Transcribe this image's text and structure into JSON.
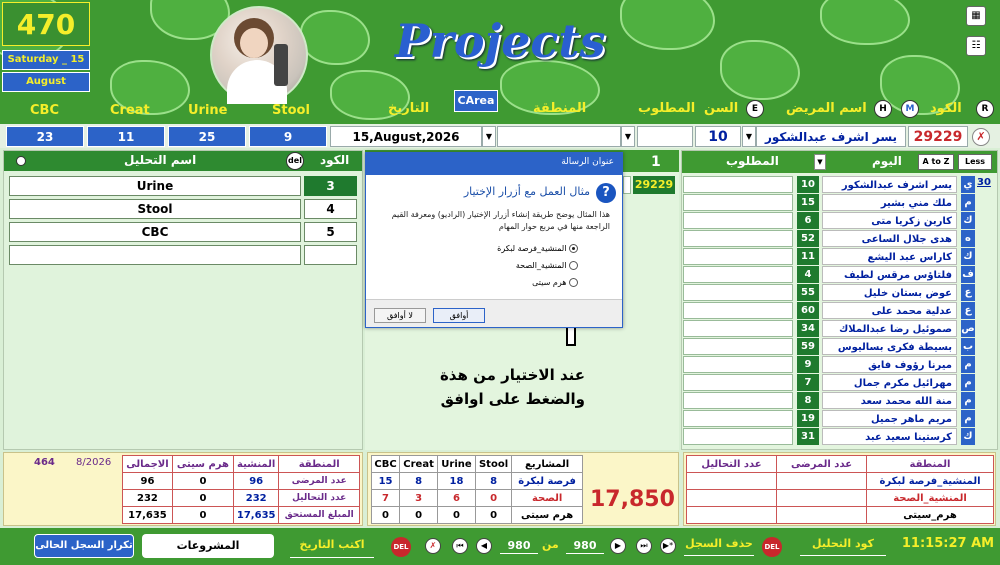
{
  "header": {
    "counter": "470",
    "day": "Saturday _ 15",
    "month": "August",
    "app_title": "Projects",
    "carea_label": "CArea",
    "fields": {
      "cbc": "CBC",
      "creat": "Creat",
      "urine": "Urine",
      "stool": "Stool",
      "date": "التاريخ",
      "region": "المنطقة",
      "required": "المطلوب",
      "age": "السن",
      "patient_name": "اسم المريض",
      "code": "الكود"
    },
    "btn_e": "E",
    "btn_h": "H",
    "btn_m": "M",
    "btn_r": "R"
  },
  "fieldbar": {
    "cbc": "23",
    "creat": "11",
    "urine": "25",
    "stool": "9",
    "date_value": "15,August,2026",
    "age_value": "10",
    "patient_value": "يسر اشرف عبدالشكور",
    "code_value": "29229"
  },
  "left_panel": {
    "code_header": "الكود",
    "del_label": "del",
    "test_name_header": "اسم التحليل",
    "rows": [
      {
        "name": "Urine",
        "code": "3"
      },
      {
        "name": "Stool",
        "code": "4"
      },
      {
        "name": "CBC",
        "code": "5"
      }
    ]
  },
  "middle": {
    "num_label": "1",
    "code_badge": "29229",
    "annotation_line1": "عند الاختيار من هذة",
    "annotation_line2": "والضغط على اوافق"
  },
  "dialog": {
    "title": "عنوان الرسالة",
    "heading": "مثال العمل مع أزرار الإختيار",
    "body": "هذا المثال يوضح طريقة إنشاء أزرار الإختيار (الراديو) ومعرفة القيم الراجعة منها  في مربع حوار المهام",
    "options": [
      "المنشية_فرصة لبكرة",
      "المنشية_الصحة",
      "هرم سيتى"
    ],
    "ok_label": "أوافق",
    "cancel_label": "لا أوافق",
    "info_icon": "?"
  },
  "right_panel": {
    "required_header": "المطلوب",
    "day_header": "اليوم",
    "atoz_label": "A to Z",
    "less_label": "Less",
    "first_num": "30",
    "patients": [
      {
        "ch": "ي",
        "name": "يسر اشرف عبدالشكور",
        "num": "10"
      },
      {
        "ch": "م",
        "name": "ملك مني بشير",
        "num": "15"
      },
      {
        "ch": "ك",
        "name": "كارين زكريا متى",
        "num": "6"
      },
      {
        "ch": "ه",
        "name": "هدى جلال الساعى",
        "num": "52"
      },
      {
        "ch": "ك",
        "name": "كاراس عبد اليشع",
        "num": "11"
      },
      {
        "ch": "ف",
        "name": "فلتاؤس مرقس لطيف",
        "num": "4"
      },
      {
        "ch": "ع",
        "name": "عوض بستان خليل",
        "num": "55"
      },
      {
        "ch": "ع",
        "name": "عدلية محمد على",
        "num": "60"
      },
      {
        "ch": "ص",
        "name": "صموئيل رضا عبدالملاك",
        "num": "34"
      },
      {
        "ch": "ب",
        "name": "بسيطة فكرى بساليوس",
        "num": "59"
      },
      {
        "ch": "م",
        "name": "ميرنا رؤوف فايق",
        "num": "9"
      },
      {
        "ch": "م",
        "name": "مهرائيل مكرم جمال",
        "num": "7"
      },
      {
        "ch": "م",
        "name": "منة الله محمد سعد",
        "num": "8"
      },
      {
        "ch": "م",
        "name": "مريم ماهر جميل",
        "num": "19"
      },
      {
        "ch": "ك",
        "name": "كرستينا سعيد عبد",
        "num": "31"
      }
    ]
  },
  "bottom_left": {
    "count": "464",
    "period": "8/2026",
    "headers": [
      "الاجمالى",
      "هرم سيتى",
      "المنشية",
      "المنطقة"
    ],
    "rows": [
      {
        "label": "عدد المرضى",
        "total": "96",
        "haram": "0",
        "mansheya": "96"
      },
      {
        "label": "عدد التحاليل",
        "total": "232",
        "haram": "0",
        "mansheya": "232"
      },
      {
        "label": "المبلغ المستحق",
        "total": "17,635",
        "haram": "0",
        "mansheya": "17,635"
      }
    ]
  },
  "bottom_mid": {
    "total": "17,850",
    "headers": [
      "CBC",
      "Creat",
      "Urine",
      "Stool",
      "المشاريع"
    ],
    "rows": [
      {
        "label": "فرصة لبكرة",
        "cbc": "15",
        "creat": "8",
        "urine": "18",
        "stool": "8"
      },
      {
        "label": "الصحة",
        "cbc": "7",
        "creat": "3",
        "urine": "6",
        "stool": "0"
      },
      {
        "label": "هرم سيتى",
        "cbc": "0",
        "creat": "0",
        "urine": "0",
        "stool": "0"
      }
    ]
  },
  "bottom_right": {
    "headers": [
      "عدد التحاليل",
      "عدد المرضى",
      "المنطقة"
    ],
    "rows": [
      "المنشية_فرصة لبكرة",
      "المنشية_الصحة",
      "هرم_سيتى"
    ]
  },
  "footer": {
    "repeat_btn": "تكرار السجل الحالى",
    "projects_field": "المشروعات",
    "write_date": "اكتب التاريخ",
    "del_label": "DEL",
    "rec_from": "980",
    "rec_from_label": "من",
    "rec_to": "980",
    "delete_record": "حذف السجل",
    "test_code": "كود التحليل",
    "time": "11:15:27 AM"
  }
}
